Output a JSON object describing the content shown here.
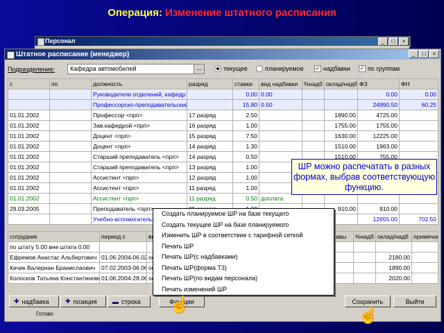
{
  "slide": {
    "title_prefix": "Операция:",
    "title_highlight": "Изменение штатного расписания"
  },
  "outer_window": {
    "title": "Персонал",
    "status": "Готово"
  },
  "window": {
    "title": "Штатное расписание (менеджер)",
    "subdivision_label": "Подразделение:",
    "subdivision_value": "Кафедра автомобилей",
    "browse_label": "...",
    "radio_current": "текущее",
    "radio_planned": "планируемое",
    "check_allowances": "надбавки",
    "check_groups": "по группам"
  },
  "grid1": {
    "headers": [
      "с",
      "по",
      "должность",
      "разряд",
      "ставки",
      "вид надбавки",
      "%надб",
      "оклад/надб",
      "ФЗ",
      "ФН"
    ],
    "rows": [
      {
        "kind": "blue",
        "cells": [
          "",
          "",
          "Руководители отделений, кафедр",
          "",
          "0.00",
          "0.00",
          "",
          "",
          "0.00",
          "0.00"
        ]
      },
      {
        "kind": "blue",
        "cells": [
          "",
          "",
          "Профессорско-преподавательский",
          "",
          "15.80",
          "0.50",
          "",
          "",
          "24990.50",
          "60.25"
        ]
      },
      {
        "kind": "",
        "cells": [
          "01.01.2002",
          "",
          "Профессор <прп>",
          "17 разряд",
          "2.50",
          "",
          "",
          "1890.00",
          "4725.00",
          ""
        ]
      },
      {
        "kind": "",
        "cells": [
          "01.01.2002",
          "",
          "Зав.кафедрой <прп>",
          "16 разряд",
          "1.00",
          "",
          "",
          "1755.00",
          "1755.00",
          ""
        ]
      },
      {
        "kind": "",
        "cells": [
          "01.01.2002",
          "",
          "Доцент <прп>",
          "15 разряд",
          "7.50",
          "",
          "",
          "1630.00",
          "12225.00",
          ""
        ]
      },
      {
        "kind": "",
        "cells": [
          "01.01.2002",
          "",
          "Доцент <прп>",
          "14 разряд",
          "1.30",
          "",
          "",
          "1510.00",
          "1963.00",
          ""
        ]
      },
      {
        "kind": "",
        "cells": [
          "01.01.2002",
          "",
          "Старший преподаватель <прп>",
          "14 разряд",
          "0.50",
          "",
          "",
          "1510.00",
          "755.00",
          ""
        ]
      },
      {
        "kind": "",
        "cells": [
          "01.01.2002",
          "",
          "Старший преподаватель <прп>",
          "13 разряд",
          "1.00",
          "",
          "",
          "",
          "",
          ""
        ]
      },
      {
        "kind": "",
        "cells": [
          "01.01.2002",
          "",
          "Ассистент <прп>",
          "12 разряд",
          "1.00",
          "",
          "",
          "",
          "",
          ""
        ]
      },
      {
        "kind": "",
        "cells": [
          "01.01.2002",
          "",
          "Ассистент <прп>",
          "11 разряд",
          "1.00",
          "",
          "",
          "",
          "",
          ""
        ]
      },
      {
        "kind": "green",
        "cells": [
          "01.01.2002",
          "",
          "Ассистент <прп>",
          "11 разряд",
          "0.50",
          "доплата",
          "",
          "",
          "",
          ""
        ]
      },
      {
        "kind": "",
        "cells": [
          "29.03.2005",
          "",
          "Преподаватель <прп>",
          "05 разряд",
          "1.00",
          "",
          "",
          "910.00",
          "910.00",
          ""
        ]
      },
      {
        "kind": "total",
        "cells": [
          "",
          "",
          "Учебно-вспомогательный",
          "",
          "",
          "",
          "",
          "",
          "12655.00",
          "702.50"
        ]
      }
    ]
  },
  "grid2": {
    "headers": [
      "сотрудник",
      "период с",
      "ви",
      "",
      "",
      "ставы",
      "%надб",
      "оклад/надб",
      "примечан"
    ],
    "rows": [
      {
        "cells": [
          "по штату 5.00 вне штата 0.00",
          "",
          "",
          "",
          "",
          "",
          "",
          "",
          ""
        ]
      },
      {
        "cells": [
          "Ефремов Анастас Альбертович",
          "01.06.2004-06.02",
          "ос",
          "",
          "",
          "",
          "",
          "2180.00",
          ""
        ]
      },
      {
        "cells": [
          "Кичик Валериан Бранислаович",
          "07.02.2003-06.06",
          "ос",
          "",
          "",
          "",
          "",
          "1890.00",
          ""
        ]
      },
      {
        "cells": [
          "Колосков Татьяна Константиновна",
          "01.06.2004-28.06",
          "ос",
          "",
          "",
          "",
          "",
          "2020.00",
          ""
        ]
      }
    ]
  },
  "callout": "ШР можно распечатать в разных формах, выбрав соответствующую функцию.",
  "menu": [
    "Создать планируемое ШР на базе текущего",
    "Создать текущее ШР на базе планируемого",
    "Изменить ШР в соответствие с тарифной сеткой",
    "Печать ШР",
    "Печать ШР(с надбавками)",
    "Печать ШР(форма Т3)",
    "Печать ШР(по видам персонала)",
    "Печать изменений ШР"
  ],
  "buttons": {
    "allowance": "надбавка",
    "position": "позиция",
    "row": "строка",
    "functions": "Функции",
    "save": "Сохранить",
    "exit": "Выйти"
  }
}
